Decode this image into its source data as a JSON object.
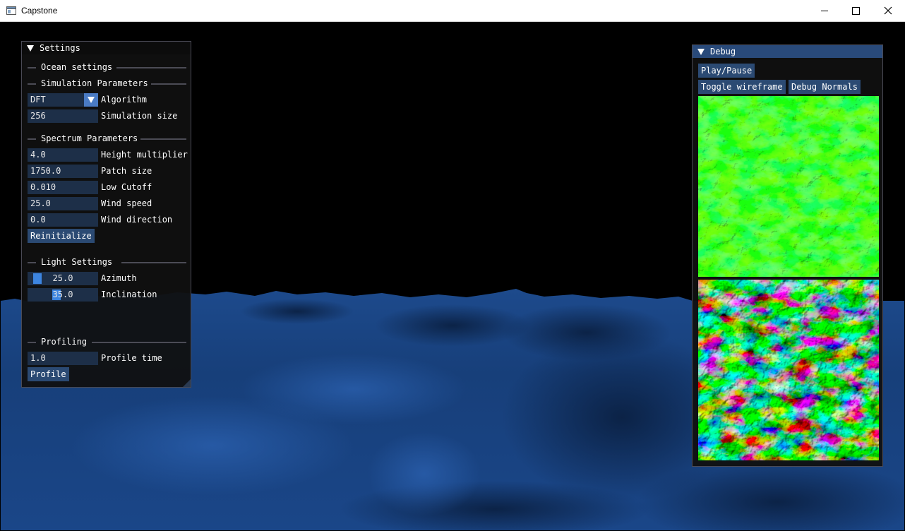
{
  "window": {
    "title": "Capstone",
    "icons": {
      "app": "app-window-icon",
      "minimize": "minimize-icon",
      "maximize": "maximize-icon",
      "close": "close-icon"
    }
  },
  "colors": {
    "ocean": "#16407e",
    "panel_bg": "#101010",
    "field_bg": "#1d2f48",
    "button_bg": "#2b4a73",
    "title_bar_active": "#294a7a",
    "slider_grab": "#3d85e0"
  },
  "settings": {
    "title": "Settings",
    "ocean_settings": "Ocean settings",
    "simulation_params": "Simulation Parameters",
    "algorithm": {
      "value": "DFT",
      "label": "Algorithm"
    },
    "simulation_size": {
      "value": "256",
      "label": "Simulation size"
    },
    "spectrum_params": "Spectrum Parameters",
    "height_multiplier": {
      "value": "4.0",
      "label": "Height multiplier"
    },
    "patch_size": {
      "value": "1750.0",
      "label": "Patch size"
    },
    "low_cutoff": {
      "value": "0.010",
      "label": "Low Cutoff"
    },
    "wind_speed": {
      "value": "25.0",
      "label": "Wind speed"
    },
    "wind_direction": {
      "value": "0.0",
      "label": "Wind direction"
    },
    "reinitialize": "Reinitialize",
    "light_settings": "Light Settings",
    "azimuth": {
      "value": "25.0",
      "label": "Azimuth",
      "fraction": 0.07
    },
    "inclination": {
      "value": "35.0",
      "label": "Inclination",
      "fraction": 0.39
    },
    "profiling": "Profiling",
    "profile_time": {
      "value": "1.0",
      "label": "Profile time"
    },
    "profile": "Profile"
  },
  "debug": {
    "title": "Debug",
    "play_pause": "Play/Pause",
    "toggle_wireframe": "Toggle wireframe",
    "debug_normals": "Debug Normals"
  }
}
